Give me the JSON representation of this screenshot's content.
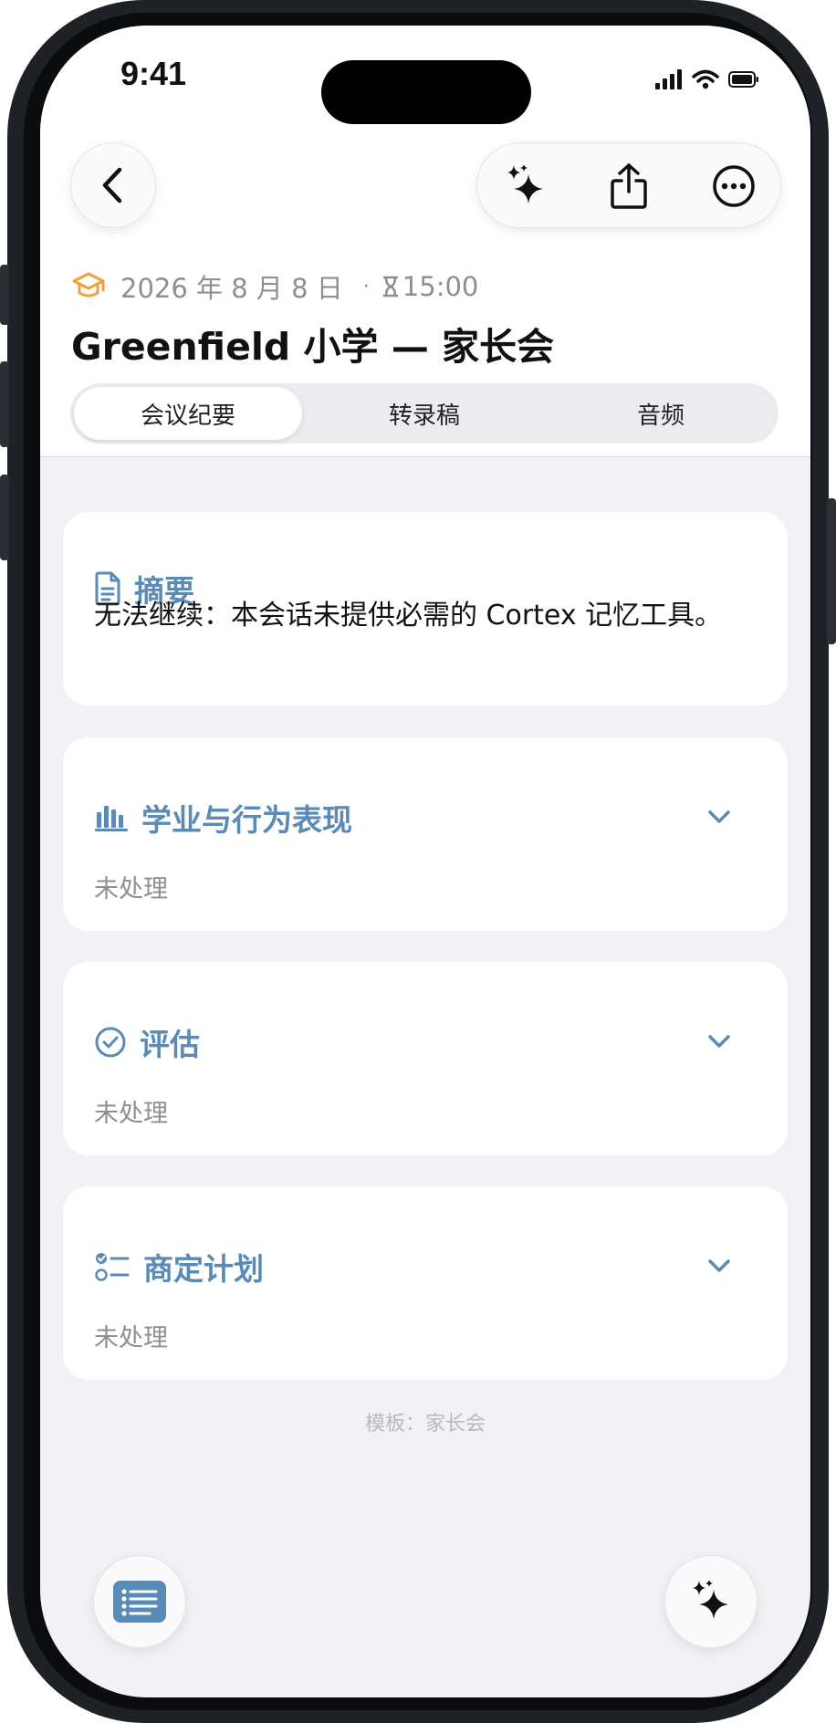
{
  "status_bar": {
    "time": "9:41"
  },
  "meeting": {
    "date": "2026 年 8 月 8 日",
    "separator": "·",
    "time": "15:00",
    "title": "Greenfield 小学 — 家长会"
  },
  "tabs": [
    {
      "label": "会议纪要",
      "active": true
    },
    {
      "label": "转录稿",
      "active": false
    },
    {
      "label": "音频",
      "active": false
    }
  ],
  "summary": {
    "heading": "摘要",
    "text": "无法继续：本会话未提供必需的 Cortex 记忆工具。"
  },
  "sections": [
    {
      "heading": "学业与行为表现",
      "status": "未处理",
      "icon": "bar-chart-icon"
    },
    {
      "heading": "评估",
      "status": "未处理",
      "icon": "check-circle-icon"
    },
    {
      "heading": "商定计划",
      "status": "未处理",
      "icon": "checklist-icon"
    }
  ],
  "footer": {
    "template": "模板：家长会"
  },
  "colors": {
    "accent": "#5a8ab8",
    "orange": "#f0a13c",
    "background": "#f1f1f6"
  }
}
